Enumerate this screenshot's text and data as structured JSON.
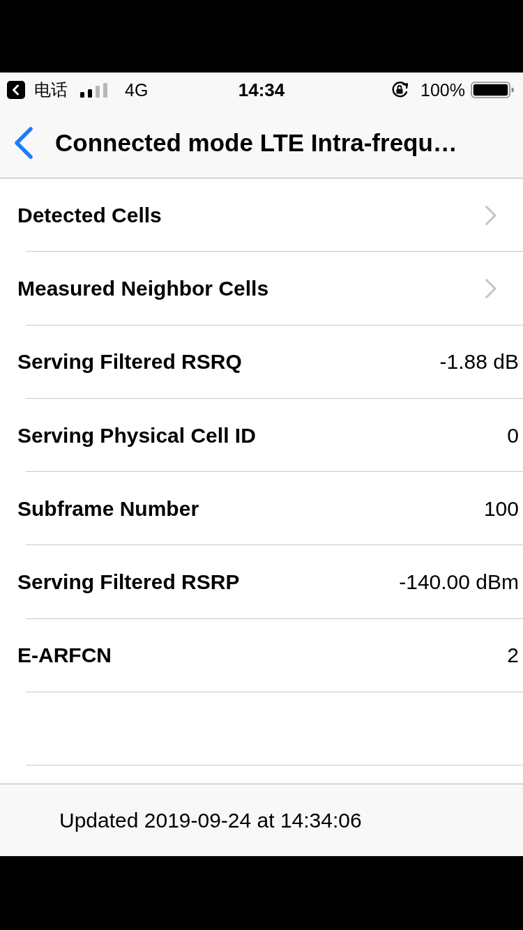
{
  "status_bar": {
    "back_app": "电话",
    "network": "4G",
    "time": "14:34",
    "battery": "100%"
  },
  "nav": {
    "title": "Connected mode LTE Intra-frequ…"
  },
  "rows": [
    {
      "kind": "link",
      "label": "Detected Cells"
    },
    {
      "kind": "link",
      "label": "Measured Neighbor Cells"
    },
    {
      "kind": "value",
      "label": "Serving Filtered RSRQ",
      "value": "-1.88 dB"
    },
    {
      "kind": "value",
      "label": "Serving Physical Cell ID",
      "value": "0"
    },
    {
      "kind": "value",
      "label": "Subframe Number",
      "value": "100"
    },
    {
      "kind": "value",
      "label": "Serving Filtered RSRP",
      "value": "-140.00 dBm"
    },
    {
      "kind": "value",
      "label": "E-ARFCN",
      "value": "2"
    },
    {
      "kind": "empty"
    }
  ],
  "footer": {
    "text": "Updated 2019-09-24 at 14:34:06"
  }
}
